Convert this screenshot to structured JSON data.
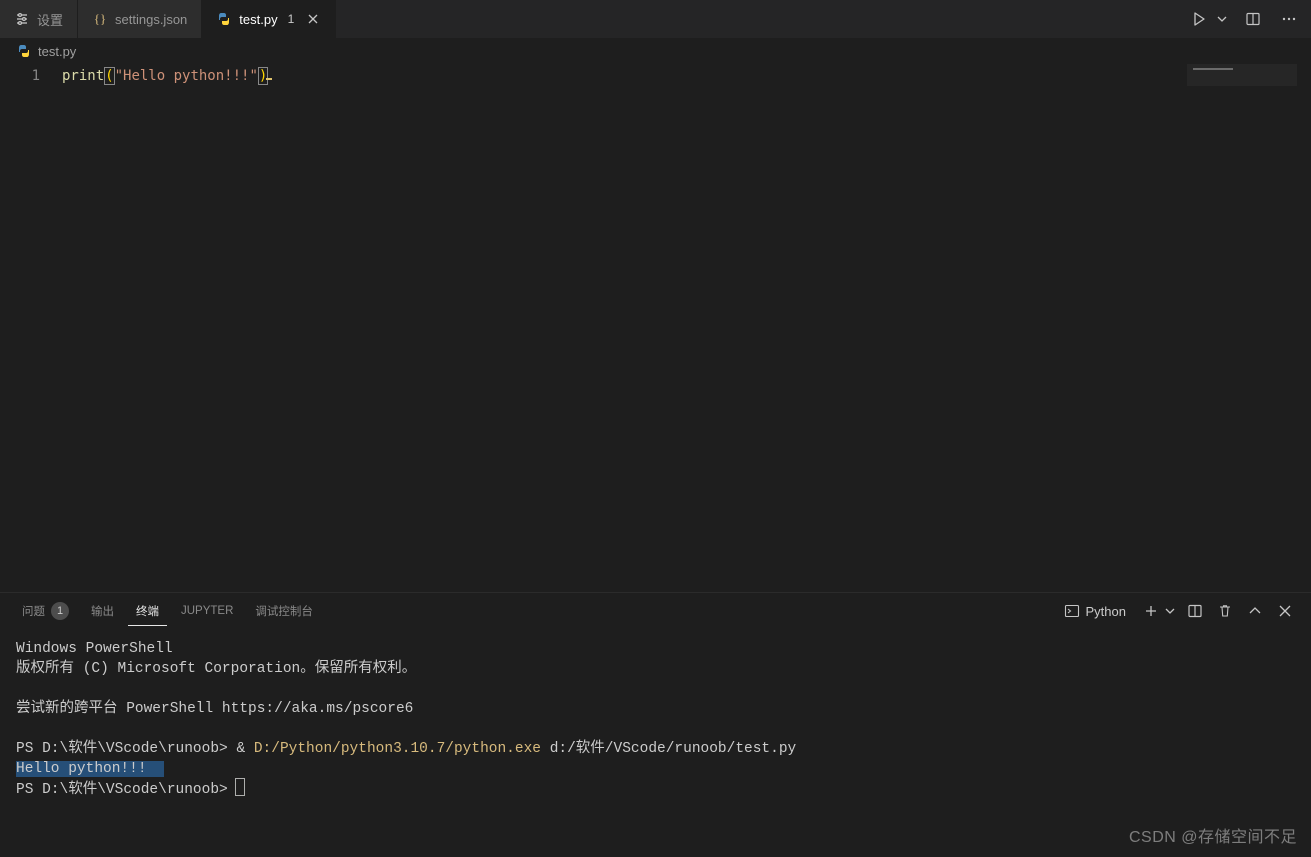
{
  "tabs": [
    {
      "label": "设置",
      "icon": "settings-list-icon"
    },
    {
      "label": "settings.json",
      "icon": "json-braces-icon"
    },
    {
      "label": "test.py",
      "icon": "python-file-icon",
      "badge": "1",
      "active": true,
      "close": true
    }
  ],
  "title_actions": {
    "run": "run-icon",
    "run_menu": "chevron-down-icon",
    "split": "split-editor-icon",
    "more": "more-icon"
  },
  "breadcrumb": {
    "file_icon": "python-file-icon",
    "file": "test.py"
  },
  "editor": {
    "line_number": "1",
    "tokens": {
      "fn": "print",
      "lparen": "(",
      "str": "\"Hello python!!!\"",
      "rparen": ")"
    }
  },
  "panel": {
    "tabs": {
      "problems": "问题",
      "problems_count": "1",
      "output": "输出",
      "terminal": "终端",
      "jupyter": "JUPYTER",
      "debug": "调试控制台"
    },
    "terminal_selector": {
      "icon": "terminal-icon",
      "label": "Python"
    },
    "actions": {
      "new": "plus-icon",
      "new_menu": "chevron-down-icon",
      "split": "split-panel-icon",
      "kill": "trash-icon",
      "maximize": "chevron-up-icon",
      "close": "close-icon"
    }
  },
  "terminal": {
    "line1": "Windows PowerShell",
    "line2": "版权所有 (C) Microsoft Corporation。保留所有权利。",
    "line3": "尝试新的跨平台 PowerShell https://aka.ms/pscore6",
    "line4_prompt": "PS D:\\软件\\VScode\\runoob> ",
    "line4_amp": "& ",
    "line4_exe": "D:/Python/python3.10.7/python.exe",
    "line4_arg": " d:/软件/VScode/runoob/test.py",
    "line5_out": "Hello python!!!",
    "line6_prompt": "PS D:\\软件\\VScode\\runoob> "
  },
  "watermark": "CSDN @存储空间不足"
}
